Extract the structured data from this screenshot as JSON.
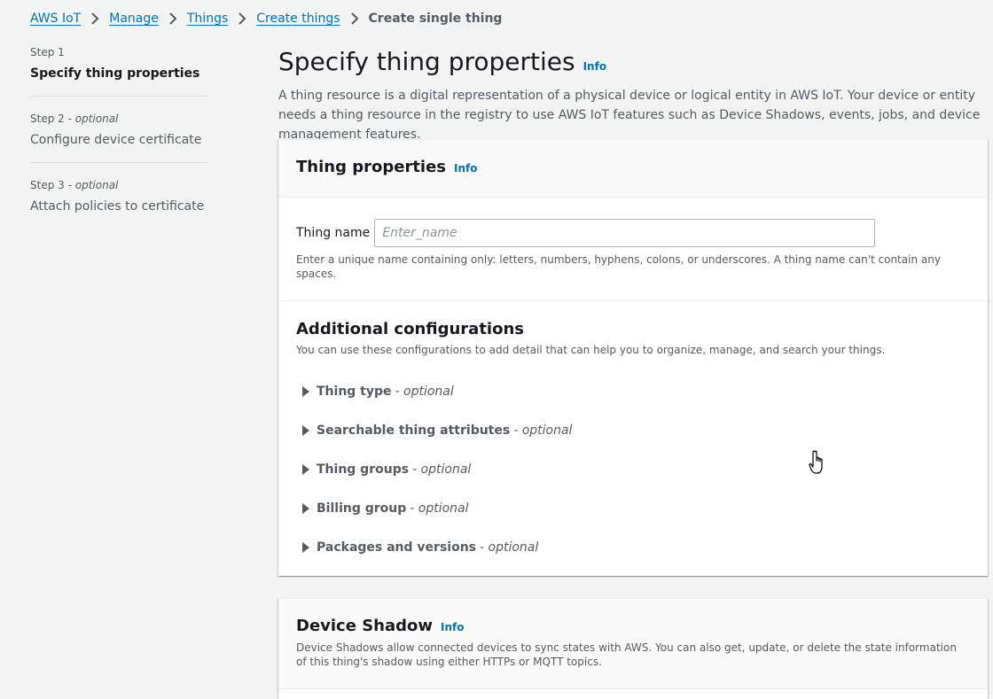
{
  "breadcrumb": {
    "items": [
      "AWS IoT",
      "Manage",
      "Things",
      "Create things"
    ],
    "current": "Create single thing"
  },
  "steps": [
    {
      "label": "Step 1",
      "optional": "",
      "title": "Specify thing properties",
      "active": true
    },
    {
      "label": "Step 2",
      "optional": "- optional",
      "title": "Configure device certificate",
      "active": false
    },
    {
      "label": "Step 3",
      "optional": "- optional",
      "title": "Attach policies to certificate",
      "active": false
    }
  ],
  "page": {
    "title": "Specify thing properties",
    "info": "Info",
    "description": "A thing resource is a digital representation of a physical device or logical entity in AWS IoT. Your device or entity needs a thing resource in the registry to use AWS IoT features such as Device Shadows, events, jobs, and device management features."
  },
  "thing_properties": {
    "title": "Thing properties",
    "info": "Info",
    "thing_name_label": "Thing name",
    "thing_name_value": "",
    "thing_name_placeholder": "Enter_name",
    "thing_name_hint": "Enter a unique name containing only: letters, numbers, hyphens, colons, or underscores. A thing name can't contain any spaces."
  },
  "additional": {
    "title": "Additional configurations",
    "description": "You can use these configurations to add detail that can help you to organize, manage, and search your things.",
    "optional_suffix": "- optional",
    "sections": [
      "Thing type",
      "Searchable thing attributes",
      "Thing groups",
      "Billing group",
      "Packages and versions"
    ]
  },
  "device_shadow": {
    "title": "Device Shadow",
    "info": "Info",
    "description": "Device Shadows allow connected devices to sync states with AWS. You can also get, update, or delete the state information of this thing's shadow using either HTTPs or MQTT topics."
  },
  "colors": {
    "link": "#0073bb",
    "background": "#f2f3f3",
    "text_primary": "#16191f",
    "text_secondary": "#545b64"
  },
  "icons": {
    "breadcrumb_separator": "chevron-right-icon",
    "expander": "caret-right-icon",
    "cursor": "hand-pointer-icon"
  }
}
